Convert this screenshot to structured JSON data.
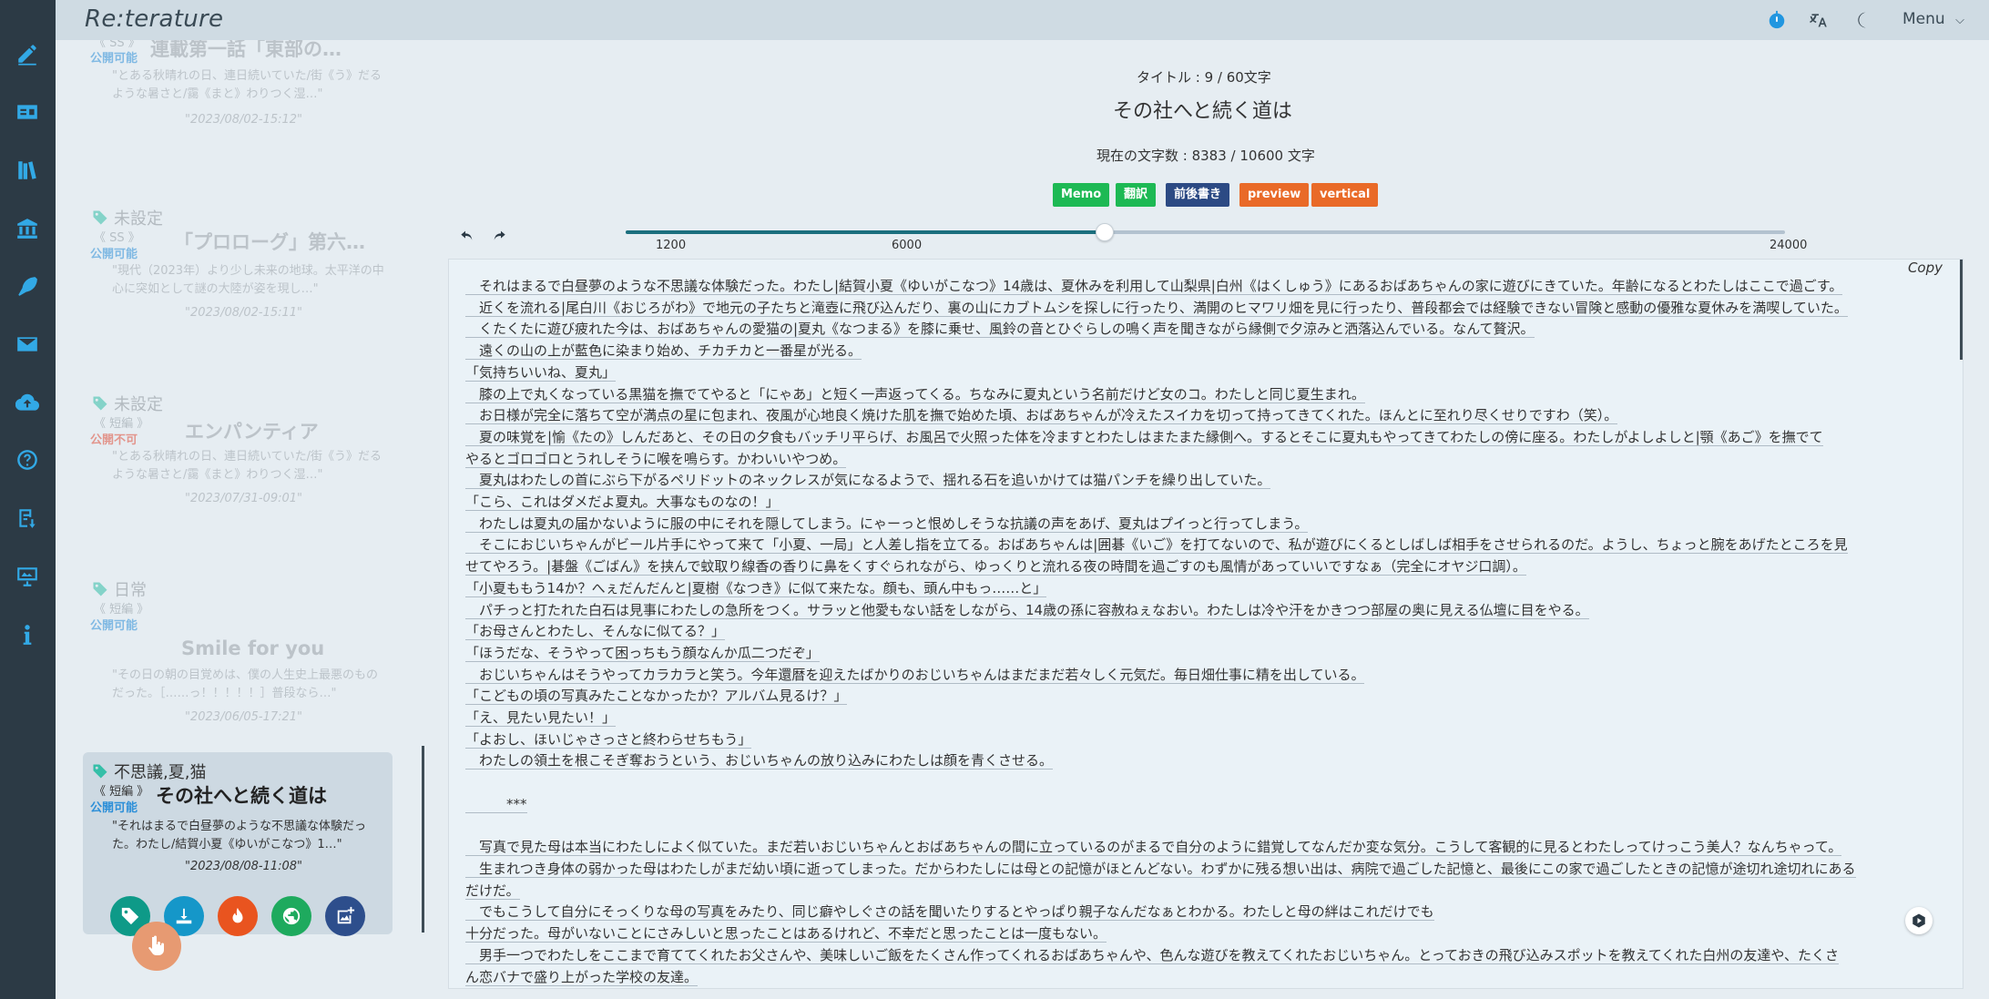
{
  "app": {
    "brand": "Re:terature",
    "menu_label": "Menu"
  },
  "sidebar_icons": [
    "pencil-icon",
    "id-card-icon",
    "library-icon",
    "bank-icon",
    "feather-icon",
    "mail-icon",
    "cloud-upload-icon",
    "help-icon",
    "import-icon",
    "presentation-icon",
    "info-icon"
  ],
  "stories": [
    {
      "tags": "",
      "kind": "《 SS 》",
      "status": "公開可能",
      "title": "連載第一話「東部の…",
      "excerpt": "\"とある秋晴れの日、連日続いていた/街《う》だるような暑さと/靄《まと》わりつく湿…\"",
      "date": "\"2023/08/02-15:12\""
    },
    {
      "tags": "未設定",
      "kind": "《 SS 》",
      "status": "公開可能",
      "title": "「プロローグ」第六…",
      "excerpt": "\"現代（2023年）より少し未来の地球。太平洋の中心に突如として謎の大陸が姿を現し…\"",
      "date": "\"2023/08/02-15:11\""
    },
    {
      "tags": "未設定",
      "kind": "《 短編 》",
      "status": "公開不可",
      "title": "エンパンティア",
      "excerpt": "\"とある秋晴れの日、連日続いていた/街《う》だるような暑さと/靄《まと》わりつく湿…\"",
      "date": "\"2023/07/31-09:01\""
    },
    {
      "tags": "日常",
      "kind": "《 短編 》",
      "status": "公開可能",
      "title": "Smile for you",
      "excerpt": "\"その日の朝の目覚めは、僕の人生史上最悪のものだった。［……っ！！！！！］普段なら…\"",
      "date": "\"2023/06/05-17:21\""
    }
  ],
  "active_story": {
    "tags": "不思議,夏,猫",
    "kind": "《 短編 》",
    "status": "公開可能",
    "title": "その社へと続く道は",
    "excerpt": "\"それはまるで白昼夢のような不思議な体験だった。わたし/結賀小夏《ゆいがこなつ》1…\"",
    "date": "\"2023/08/08-11:08\"",
    "actions": [
      "tag-icon",
      "download-icon",
      "fire-icon",
      "globe-icon",
      "image-add-icon"
    ]
  },
  "editor": {
    "title_count": "タイトル : 9 / 60文字",
    "title": "その社へと続く道は",
    "char_count": "現在の文字数 : 8383 / 10600 文字",
    "buttons": {
      "memo": "Memo",
      "translate": "翻訳",
      "front_back": "前後書き",
      "preview": "preview",
      "vertical": "vertical"
    },
    "slider": {
      "min": 1200,
      "value": 10600,
      "max": 24000,
      "tick_labels": [
        "1200",
        "6000",
        "24000"
      ]
    },
    "copy_label": "Copy",
    "body": [
      "　それはまるで白昼夢のような不思議な体験だった。わたし|結賀小夏《ゆいがこなつ》14歳は、夏休みを利用して山梨県|白州《はくしゅう》にあるおばあちゃんの家に遊びにきていた。年齢になるとわたしはここで過ごす。",
      "　近くを流れる|尾白川《おじろがわ》で地元の子たちと滝壺に飛び込んだり、裏の山にカブトムシを探しに行ったり、満開のヒマワリ畑を見に行ったり、普段都会では経験できない冒険と感動の優雅な夏休みを満喫していた。",
      "　くたくたに遊び疲れた今は、おばあちゃんの愛猫の|夏丸《なつまる》を膝に乗せ、風鈴の音とひぐらしの鳴く声を聞きながら縁側で夕涼みと洒落込んでいる。なんて贅沢。",
      "　遠くの山の上が藍色に染まり始め、チカチカと一番星が光る。",
      "「気持ちいいね、夏丸」",
      "　膝の上で丸くなっている黒猫を撫でてやると「にゃあ」と短く一声返ってくる。ちなみに夏丸という名前だけど女のコ。わたしと同じ夏生まれ。",
      "　お日様が完全に落ちて空が満点の星に包まれ、夜風が心地良く焼けた肌を撫で始めた頃、おばあちゃんが冷えたスイカを切って持ってきてくれた。ほんとに至れり尽くせりですわ（笑）。",
      "　夏の味覚を|愉《たの》しんだあと、その日の夕食もバッチリ平らげ、お風呂で火照った体を冷ますとわたしはまたまた縁側へ。するとそこに夏丸もやってきてわたしの傍に座る。わたしがよしよしと|顎《あご》を撫でて",
      "やるとゴロゴロとうれしそうに喉を鳴らす。かわいいやつめ。",
      "　夏丸はわたしの首にぶら下がるペリドットのネックレスが気になるようで、揺れる石を追いかけては猫パンチを繰り出していた。",
      "「こら、これはダメだよ夏丸。大事なものなの！」",
      "　わたしは夏丸の届かないように服の中にそれを隠してしまう。にゃーっと恨めしそうな抗議の声をあげ、夏丸はプイっと行ってしまう。",
      "　そこにおじいちゃんがビール片手にやって来て「小夏、一局」と人差し指を立てる。おばあちゃんは|囲碁《いご》を打てないので、私が遊びにくるとしばしば相手をさせられるのだ。ようし、ちょっと腕をあげたところを見",
      "せてやろう。|碁盤《ごばん》を挟んで蚊取り線香の香りに鼻をくすぐられながら、ゆっくりと流れる夜の時間を過ごすのも風情があっていいですなぁ（完全にオヤジ口調）。",
      "「小夏ももう14か？へぇだんだんと|夏樹《なつき》に似て来たな。顔も、頭ん中もっ……と」",
      "　パチっと打たれた白石は見事にわたしの急所をつく。サラッと他愛もない話をしながら、14歳の孫に容赦ねぇなおい。わたしは冷や汗をかきつつ部屋の奥に見える仏壇に目をやる。",
      "「お母さんとわたし、そんなに似てる？」",
      "「ほうだな、そうやって困っちもう顔なんか瓜二つだぞ」",
      "　おじいちゃんはそうやってカラカラと笑う。今年還暦を迎えたばかりのおじいちゃんはまだまだ若々しく元気だ。毎日畑仕事に精を出している。",
      "「こどもの頃の写真みたことなかったか？アルバム見るけ？」",
      "「え、見たい見たい！」",
      "「よおし、ほいじゃさっさと終わらせちもう」",
      "　わたしの領土を根こそぎ奪おうという、おじいちゃんの放り込みにわたしは顔を青くさせる。",
      "",
      "　　　***",
      "",
      "　写真で見た母は本当にわたしによく似ていた。まだ若いおじいちゃんとおばあちゃんの間に立っているのがまるで自分のように錯覚してなんだか変な気分。こうして客観的に見るとわたしってけっこう美人？なんちゃって。",
      "　生まれつき身体の弱かった母はわたしがまだ幼い頃に逝ってしまった。だからわたしには母との記憶がほとんどない。わずかに残る想い出は、病院で過ごした記憶と、最後にこの家で過ごしたときの記憶が途切れ途切れにある",
      "だけだ。",
      "　でもこうして自分にそっくりな母の写真をみたり、同じ癖やしぐさの話を聞いたりするとやっぱり親子なんだなぁとわかる。わたしと母の絆はこれだけでも",
      "十分だった。母がいないことにさみしいと思ったことはあるけれど、不幸だと思ったことは一度もない。",
      "　男手一つでわたしをここまで育ててくれたお父さんや、美味しいご飯をたくさん作ってくれるおばあちゃんや、色んな遊びを教えてくれたおじいちゃん。とっておきの飛び込みスポットを教えてくれた白州の友達や、たくさ",
      "ん恋バナで盛り上がった学校の友達。"
    ]
  },
  "colors": {
    "rail": "#2c3a45",
    "accent_blue": "#32a9e6",
    "memo": "#1db954",
    "translate": "#1db954",
    "front_back": "#2c4a84",
    "preview": "#e96a28",
    "vertical": "#e96a28"
  }
}
